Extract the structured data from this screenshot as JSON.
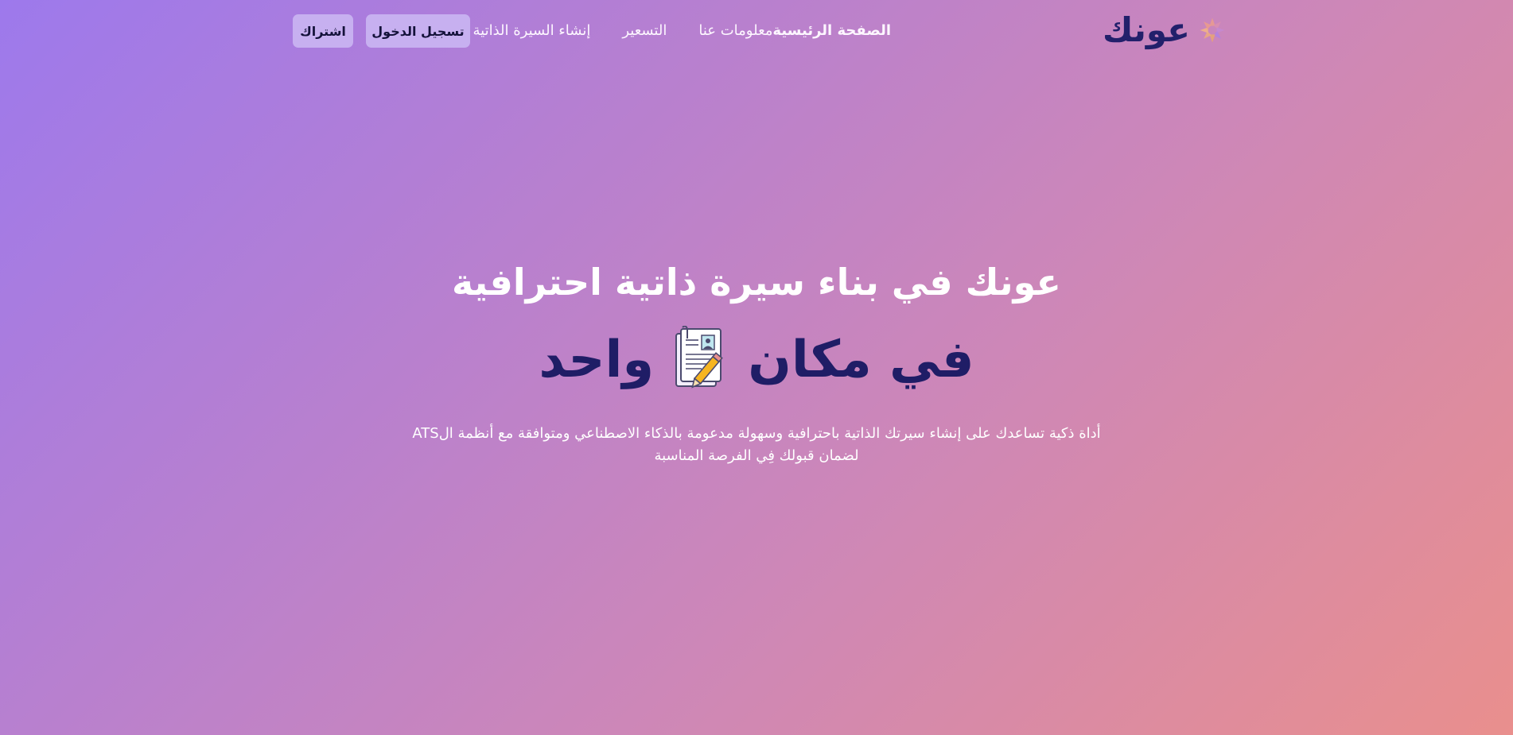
{
  "brand": {
    "name": "عونك",
    "colors": {
      "primary": "#22206b",
      "button_bg": "#c7b0f0",
      "gradient_start": "#9d79ec",
      "gradient_end": "#e98f8d"
    },
    "logo_icon": "sunburst-logo-icon"
  },
  "nav": {
    "home": "الصفحة الرئيسية",
    "about": "معلومات عنا",
    "pricing": "التسعير",
    "create_cv": "إنشاء السيرة الذاتية"
  },
  "buttons": {
    "login": "تسجيل الدخول",
    "subscribe": "اشتراك"
  },
  "hero": {
    "title_line1": "عونك في بناء سيرة ذاتية احترافية",
    "title_part_a": "في مكان",
    "title_part_b": "واحد",
    "icon": "resume-pencil-icon",
    "subtitle_line1": "أداة ذكية تساعدك على إنشاء سيرتك الذاتية باحترافية وسهولة مدعومة بالذكاء الاصطناعي ومتوافقة مع أنظمة الATS",
    "subtitle_line2": "لضمان قبولك فِي الفرصة المناسبة"
  }
}
